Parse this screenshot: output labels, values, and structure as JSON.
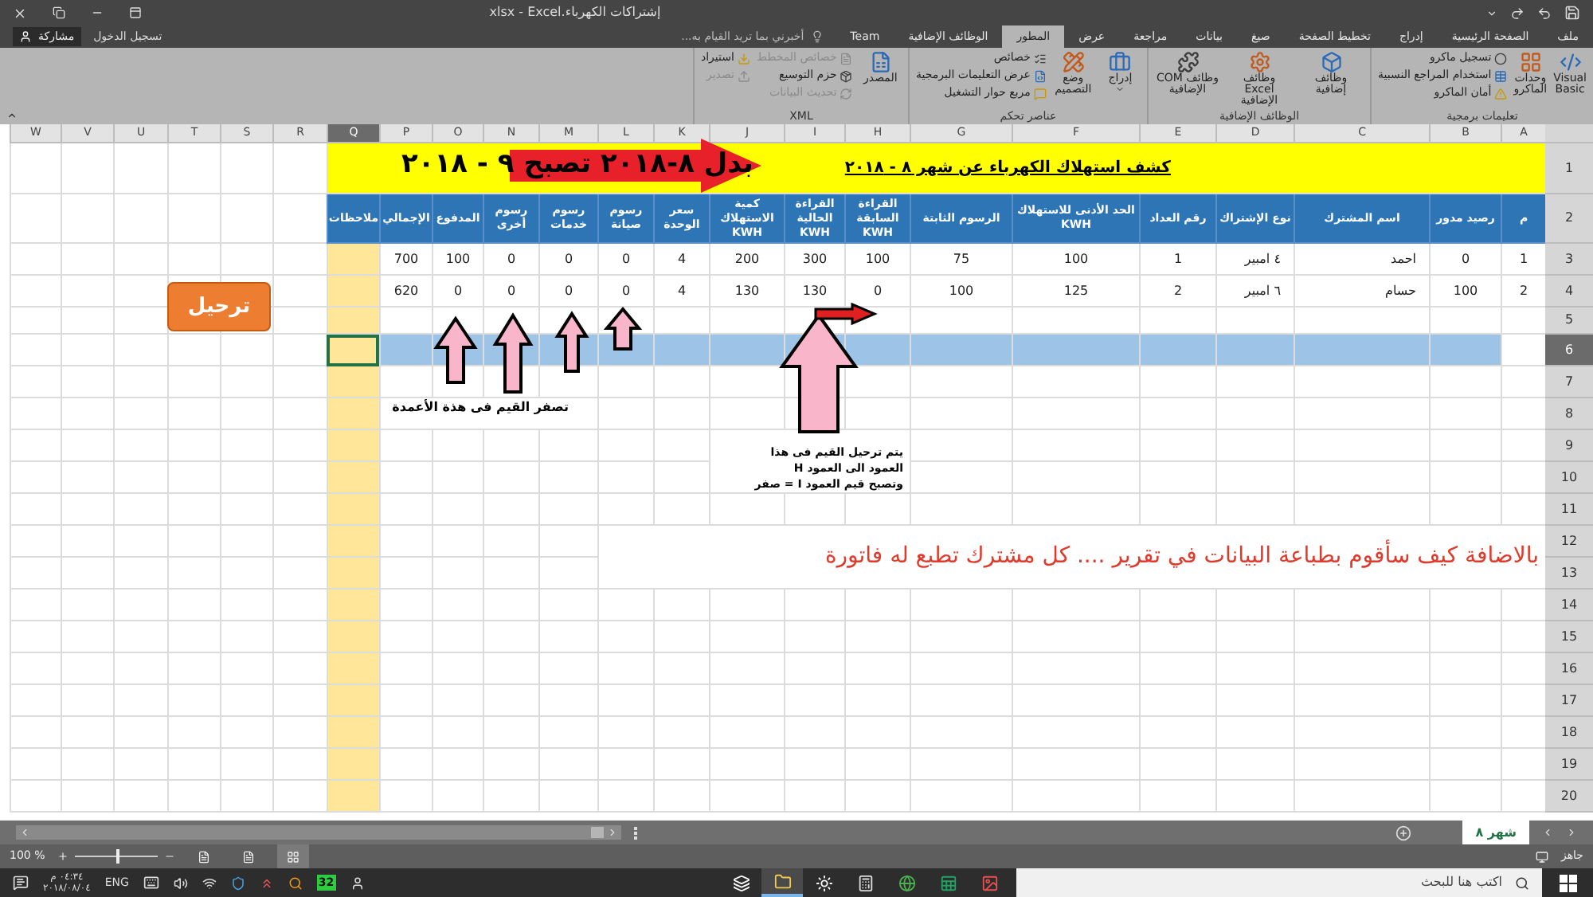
{
  "window": {
    "title": "إشتراكات الكهرباء.xlsx - Excel"
  },
  "account": {
    "sign_in": "تسجيل الدخول",
    "share": "مشاركة"
  },
  "ribbon": {
    "tabs": [
      {
        "label": "ملف",
        "selected": false
      },
      {
        "label": "الصفحة الرئيسية",
        "selected": false
      },
      {
        "label": "إدراج",
        "selected": false
      },
      {
        "label": "تخطيط الصفحة",
        "selected": false
      },
      {
        "label": "صيغ",
        "selected": false
      },
      {
        "label": "بيانات",
        "selected": false
      },
      {
        "label": "مراجعة",
        "selected": false
      },
      {
        "label": "عرض",
        "selected": false
      },
      {
        "label": "المطور",
        "selected": true
      },
      {
        "label": "الوظائف الإضافية",
        "selected": false
      },
      {
        "label": "Team",
        "selected": false
      }
    ],
    "tell_me": "أخبرني بما تريد القيام به...",
    "groups": [
      {
        "label": "تعليمات برمجية",
        "items": [
          {
            "kind": "large",
            "label": "Visual Basic",
            "disabled": false,
            "dropdown": false
          },
          {
            "kind": "large",
            "label": "وحدات الماكرو",
            "disabled": false,
            "dropdown": false
          },
          {
            "kind": "small",
            "label": "تسجيل ماكرو",
            "disabled": false,
            "dropdown": false
          },
          {
            "kind": "small",
            "label": "استخدام المراجع النسبية",
            "disabled": false,
            "dropdown": false
          },
          {
            "kind": "small",
            "label": "أمان الماكرو",
            "disabled": false,
            "dropdown": false
          }
        ]
      },
      {
        "label": "الوظائف الإضافية",
        "items": [
          {
            "kind": "large",
            "label": "وظائف إضافية",
            "disabled": false,
            "dropdown": false
          },
          {
            "kind": "large",
            "label": "وظائف Excel الإضافية",
            "disabled": false,
            "dropdown": false
          },
          {
            "kind": "large",
            "label": "وظائف COM الإضافية",
            "disabled": false,
            "dropdown": false
          }
        ]
      },
      {
        "label": "عناصر تحكم",
        "items": [
          {
            "kind": "large",
            "label": "إدراج",
            "disabled": false,
            "dropdown": true
          },
          {
            "kind": "large",
            "label": "وضع التصميم",
            "disabled": false,
            "dropdown": false
          },
          {
            "kind": "small",
            "label": "خصائص",
            "disabled": false,
            "dropdown": false
          },
          {
            "kind": "small",
            "label": "عرض التعليمات البرمجية",
            "disabled": false,
            "dropdown": false
          },
          {
            "kind": "small",
            "label": "مربع حوار التشغيل",
            "disabled": false,
            "dropdown": false
          }
        ]
      },
      {
        "label": "XML",
        "items": [
          {
            "kind": "large",
            "label": "المصدر",
            "disabled": false,
            "dropdown": false
          },
          {
            "kind": "small",
            "label": "خصائص المخطط",
            "disabled": true,
            "dropdown": false
          },
          {
            "kind": "small",
            "label": "حزم التوسيع",
            "disabled": false,
            "dropdown": false
          },
          {
            "kind": "small",
            "label": "تحديث البيانات",
            "disabled": true,
            "dropdown": false
          },
          {
            "kind": "small",
            "label": "استيراد",
            "disabled": false,
            "dropdown": false
          },
          {
            "kind": "small",
            "label": "تصدير",
            "disabled": true,
            "dropdown": false
          }
        ]
      }
    ]
  },
  "sheet": {
    "columns": [
      {
        "letter": "A",
        "active": false
      },
      {
        "letter": "B",
        "active": false
      },
      {
        "letter": "C",
        "active": false
      },
      {
        "letter": "D",
        "active": false
      },
      {
        "letter": "E",
        "active": false
      },
      {
        "letter": "F",
        "active": false
      },
      {
        "letter": "G",
        "active": false
      },
      {
        "letter": "H",
        "active": false
      },
      {
        "letter": "I",
        "active": false
      },
      {
        "letter": "J",
        "active": false
      },
      {
        "letter": "K",
        "active": false
      },
      {
        "letter": "L",
        "active": false
      },
      {
        "letter": "M",
        "active": false
      },
      {
        "letter": "N",
        "active": false
      },
      {
        "letter": "O",
        "active": false
      },
      {
        "letter": "P",
        "active": false
      },
      {
        "letter": "Q",
        "active": true
      },
      {
        "letter": "R",
        "active": false
      },
      {
        "letter": "S",
        "active": false
      },
      {
        "letter": "T",
        "active": false
      },
      {
        "letter": "U",
        "active": false
      },
      {
        "letter": "V",
        "active": false
      },
      {
        "letter": "W",
        "active": false
      }
    ],
    "title_row": {
      "number": "1",
      "title": "كشف استهلاك الكهرباء عن شهر ٨ - ٢٠١٨"
    },
    "header_row": {
      "number": "2",
      "headers": [
        "م",
        "رصيد مدور",
        "اسم المشترك",
        "نوع الإشتراك",
        "رقم العداد",
        "الحد الأدنى للاستهلاك KWH",
        "الرسوم الثابتة",
        "القراءة السابقة KWH",
        "القراءة الحالية KWH",
        "كمية الاستهلاك KWH",
        "سعر الوحدة",
        "رسوم صيانة",
        "رسوم خدمات",
        "رسوم أخرى",
        "المدفوع",
        "الإجمالي",
        "ملاحظات"
      ]
    },
    "data_rows": [
      {
        "number": "3",
        "cells": [
          "1",
          "0",
          "احمد",
          "٤ امبير",
          "1",
          "100",
          "75",
          "100",
          "300",
          "200",
          "4",
          "0",
          "0",
          "0",
          "100",
          "700"
        ]
      },
      {
        "number": "4",
        "cells": [
          "2",
          "100",
          "حسام",
          "٦ امبير",
          "2",
          "125",
          "100",
          "0",
          "130",
          "130",
          "4",
          "0",
          "0",
          "0",
          "0",
          "620"
        ]
      }
    ],
    "empty_rows": [
      {
        "number": "5",
        "highlight": false,
        "active_cell": false
      },
      {
        "number": "6",
        "highlight": true,
        "active_cell": true
      },
      {
        "number": "7",
        "highlight": false,
        "active_cell": false
      },
      {
        "number": "8",
        "highlight": false,
        "active_cell": false
      },
      {
        "number": "9",
        "highlight": false,
        "active_cell": false
      },
      {
        "number": "10",
        "highlight": false,
        "active_cell": false
      },
      {
        "number": "11",
        "highlight": false,
        "active_cell": false
      },
      {
        "number": "12",
        "highlight": false,
        "active_cell": false
      },
      {
        "number": "13",
        "highlight": false,
        "active_cell": false
      },
      {
        "number": "14",
        "highlight": false,
        "active_cell": false
      },
      {
        "number": "15",
        "highlight": false,
        "active_cell": false
      },
      {
        "number": "16",
        "highlight": false,
        "active_cell": false
      },
      {
        "number": "17",
        "highlight": false,
        "active_cell": false
      },
      {
        "number": "18",
        "highlight": false,
        "active_cell": false
      },
      {
        "number": "19",
        "highlight": false,
        "active_cell": false
      },
      {
        "number": "20",
        "highlight": false,
        "active_cell": false
      }
    ]
  },
  "overlays": {
    "note": "بدل ٨-٢٠١٨ تصبح ٩ - ٢٠١٨",
    "button": "ترحيل",
    "zero_note": "تصفر القيم فى هذة الأعمدة",
    "carry_note": [
      "يتم ترحيل القيم فى هذا",
      "العمود الى العمود H",
      "وتصبح قيم العمود I = صفر"
    ],
    "question": "بالاضافة كيف سأقوم بطباعة البيانات في تقرير .... كل مشترك تطبع له فاتورة"
  },
  "sheet_tabs": [
    {
      "label": "شهر ٨",
      "selected": true
    }
  ],
  "status_bar": {
    "status": "جاهز",
    "zoom": "100 %",
    "zoom_slider": {
      "level": 0.5
    },
    "views": [
      {
        "selected": false
      },
      {
        "selected": false
      },
      {
        "selected": true
      }
    ]
  },
  "taskbar": {
    "search_placeholder": "اكتب هنا للبحث",
    "language": "ENG",
    "time": "٠٤:٣٤ م",
    "date": "٢٠١٨/٠٨/٠٤",
    "badge": "32",
    "apps": [
      {
        "active": false
      },
      {
        "active": false
      },
      {
        "active": false
      },
      {
        "active": false
      },
      {
        "active": false
      },
      {
        "active": true
      },
      {
        "active": false
      }
    ]
  }
}
